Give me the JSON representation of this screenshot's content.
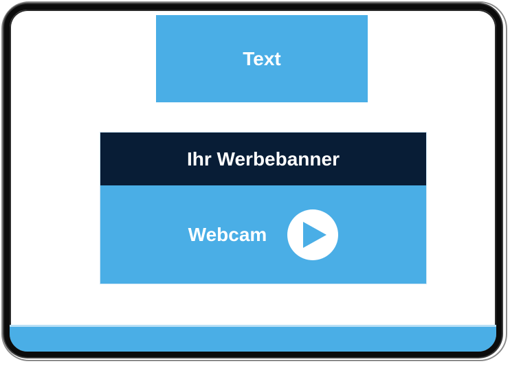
{
  "top_block": {
    "label": "Text"
  },
  "banner": {
    "header_label": "Ihr Werbebanner",
    "body_label": "Webcam",
    "icon": "play-icon"
  },
  "colors": {
    "accent_blue": "#4aaee6",
    "header_navy": "#081d36",
    "frame_black": "#0b0b0b",
    "text_white": "#ffffff"
  }
}
